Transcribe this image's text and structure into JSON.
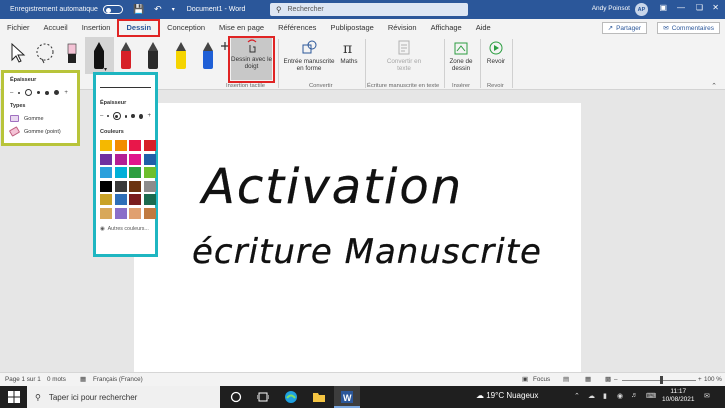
{
  "titlebar": {
    "autosave_label": "Enregistrement automatique",
    "doc_title": "Document1  -  Word",
    "search_placeholder": "Rechercher",
    "user_name": "Andy Poinsot",
    "user_initials": "AP"
  },
  "tabs": [
    "Fichier",
    "Accueil",
    "Insertion",
    "Dessin",
    "Conception",
    "Mise en page",
    "Références",
    "Publipostage",
    "Révision",
    "Affichage",
    "Aide"
  ],
  "active_tab": "Dessin",
  "share_label": "Partager",
  "comments_label": "Commentaires",
  "ribbon": {
    "draw_with_finger": "Dessin avec le doigt",
    "tactile_group": "Insertion tactile",
    "ink_to_shape": "Entrée manuscrite en forme",
    "math": "Maths",
    "convert_group": "Convertir",
    "ink_to_text": "Convertir en texte",
    "ink_text_group": "Écriture manuscrite en texte",
    "drawing_canvas": "Zone de dessin",
    "insert_group": "Insérer",
    "replay": "Revoir",
    "replay_group": "Revoir"
  },
  "flyout_left": {
    "thickness_title": "Épaisseur",
    "types_title": "Types",
    "eraser": "Gomme",
    "point_eraser": "Gomme (point)"
  },
  "flyout_right": {
    "thickness_title": "Épaisseur",
    "colors_title": "Couleurs",
    "more_colors": "Autres couleurs...",
    "swatches": [
      "#f5b800",
      "#f28c00",
      "#e8174a",
      "#d62027",
      "#7030a0",
      "#b31f94",
      "#e0148c",
      "#1f5fa8",
      "#2aa0dc",
      "#00b0d8",
      "#2c9e41",
      "#6dbf2c",
      "#000000",
      "#3a3a3a",
      "#6b3410",
      "#8c8c8c",
      "#c9a227",
      "#2f6fb8",
      "#7a1d1d",
      "#1c6b4f",
      "#d8a85a",
      "#8a6fc9",
      "#e0a070",
      "#c07a40"
    ]
  },
  "handwriting": {
    "line1": "Activation",
    "line2": "écriture Manuscrite"
  },
  "statusbar": {
    "page": "Page 1 sur 1",
    "words": "0 mots",
    "language": "Français (France)",
    "focus": "Focus",
    "zoom": "100 %"
  },
  "taskbar": {
    "search_placeholder": "Taper ici pour rechercher",
    "weather": "19°C  Nuageux",
    "time": "11:17",
    "date": "10/08/2021"
  }
}
